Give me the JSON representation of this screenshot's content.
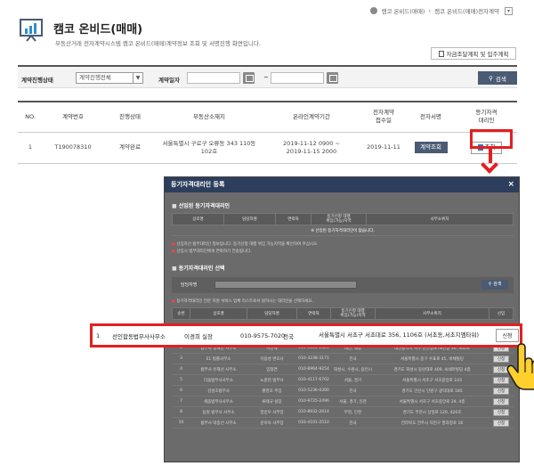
{
  "breadcrumb": [
    "캠코 온비드(매매)",
    "캠코 온비드(매매)전자계약"
  ],
  "page": {
    "title": "캠코 온비드(매매)",
    "description": "부동산거래 전자계약시스템 캠코 온비드(매매)계약정보 조회 및 서명진행 화면입니다.",
    "fund_button": "자금조달계획 및 입주계획"
  },
  "search": {
    "status_label": "계약진행상태",
    "status_value": "계약진행전체",
    "date_label": "계약일자",
    "tilde": "~",
    "search_button": "검색"
  },
  "table": {
    "headers": [
      "NO.",
      "계약번호",
      "진행상태",
      "부동산소재지",
      "온라인계약기간",
      "전자계약\n접수일",
      "전자서명",
      "등기자격\n대리인"
    ],
    "rows": [
      {
        "no": "1",
        "contract_no": "T190078310",
        "status": "계약완료",
        "address": "서울특별시 구로구 오류동 343 110동 102호",
        "period_start": "2019-11-12 0900 ~",
        "period_end": "2019-11-15 2000",
        "received": "2019-11-11",
        "sign_button": "계약조회",
        "view_button": "조회"
      }
    ]
  },
  "modal": {
    "title": "등기자격대리인 등록",
    "close": "×",
    "selected_section": "선임된 등기자격대리인",
    "selected_headers": [
      "상호명",
      "담당자명",
      "연락처",
      "등기신청 대행\n위임(가능)지역",
      "사무소위치"
    ],
    "selected_empty": "※ 선임된 등기자격대리인이 없습니다.",
    "notes": [
      "선임하신 법무대리인 정보입니다. 등기신청 대행 위임 가능지역을 확인하여 주십시오.",
      "선임시 법무대리인에게 연락하기 전송됩니다."
    ],
    "select_section": "등기자격대리인 선택",
    "agent_label": "담당자명",
    "search_button": "검색",
    "select_note": "등기자격대리인 전문 지원 서비스 업체 리스트로서 원하시는 대리인을 선택하세요.",
    "list_headers": [
      "순번",
      "상호명",
      "담당자명",
      "연락처",
      "등기신청 대행\n위임(가능)지역",
      "사무소위치",
      "선임"
    ],
    "list_rows": [
      {
        "no": "2",
        "name": "법무사 정재현 사무소",
        "agent": "이민혜",
        "tel": "010-5334-2826",
        "area": "대전, 세종",
        "loc": "대전광역시 서구 둔산중로78번길 30, 302호",
        "apply": "신청"
      },
      {
        "no": "3",
        "name": "E1 법률사무소",
        "agent": "이용성 변호사",
        "tel": "010-3238-3171",
        "area": "전국",
        "loc": "서울특별시 중구 수표로 45, 비채빌딩",
        "apply": "신청"
      },
      {
        "no": "4",
        "name": "법무사 유재선 사무소",
        "agent": "임정연",
        "tel": "010-8964-9254",
        "area": "화성시, 수원시, 용인시",
        "loc": "경기도 화성시 동탄대로 409, 씨네마빌딩 4층",
        "apply": "신청"
      },
      {
        "no": "5",
        "name": "다움법무사사무소",
        "agent": "노준현 법무사",
        "tel": "010-4117-6702",
        "area": "서울, 경기",
        "loc": "서울특별시 서초구 서초중앙로 103",
        "apply": "신청"
      },
      {
        "no": "6",
        "name": "김성호법무사",
        "agent": "황영호 주임",
        "tel": "010-5236-0300",
        "area": "전국",
        "loc": "경기도 안산시 단원구 광덕대로 185",
        "apply": "신청"
      },
      {
        "no": "7",
        "name": "세움법무사사무소",
        "agent": "류태규 실장",
        "tel": "010-9725-2496",
        "area": "서울, 경기, 인천",
        "loc": "서울특별시 서초구 서초중앙로 29, 4층",
        "apply": "신청"
      },
      {
        "no": "8",
        "name": "동원 법무사 사무소",
        "agent": "정민우 사무장",
        "tel": "010-8932-2614",
        "area": "부천, 인천",
        "loc": "경기도 부천시 상일로 120, 420호",
        "apply": "신청"
      },
      {
        "no": "10",
        "name": "법무사 박종선 사무소",
        "agent": "문이숙 사무장",
        "tel": "010-4101-2510",
        "area": "전국",
        "loc": "전라북도 전주시 덕진구 팔과정로 16",
        "apply": "신청"
      }
    ]
  },
  "highlight_row": {
    "no": "1",
    "name": "선인합동법무사사무소",
    "agent": "이경희 실장",
    "tel": "010-9575-7020",
    "area": "전국",
    "loc": "서울특별시 서초구 서초대로 356, 1106호 (서초동,서초지엠타워)",
    "apply": "신청"
  },
  "colors": {
    "accent": "#e41f1f",
    "navy": "#2c3e5c",
    "button": "#4a5b73"
  }
}
